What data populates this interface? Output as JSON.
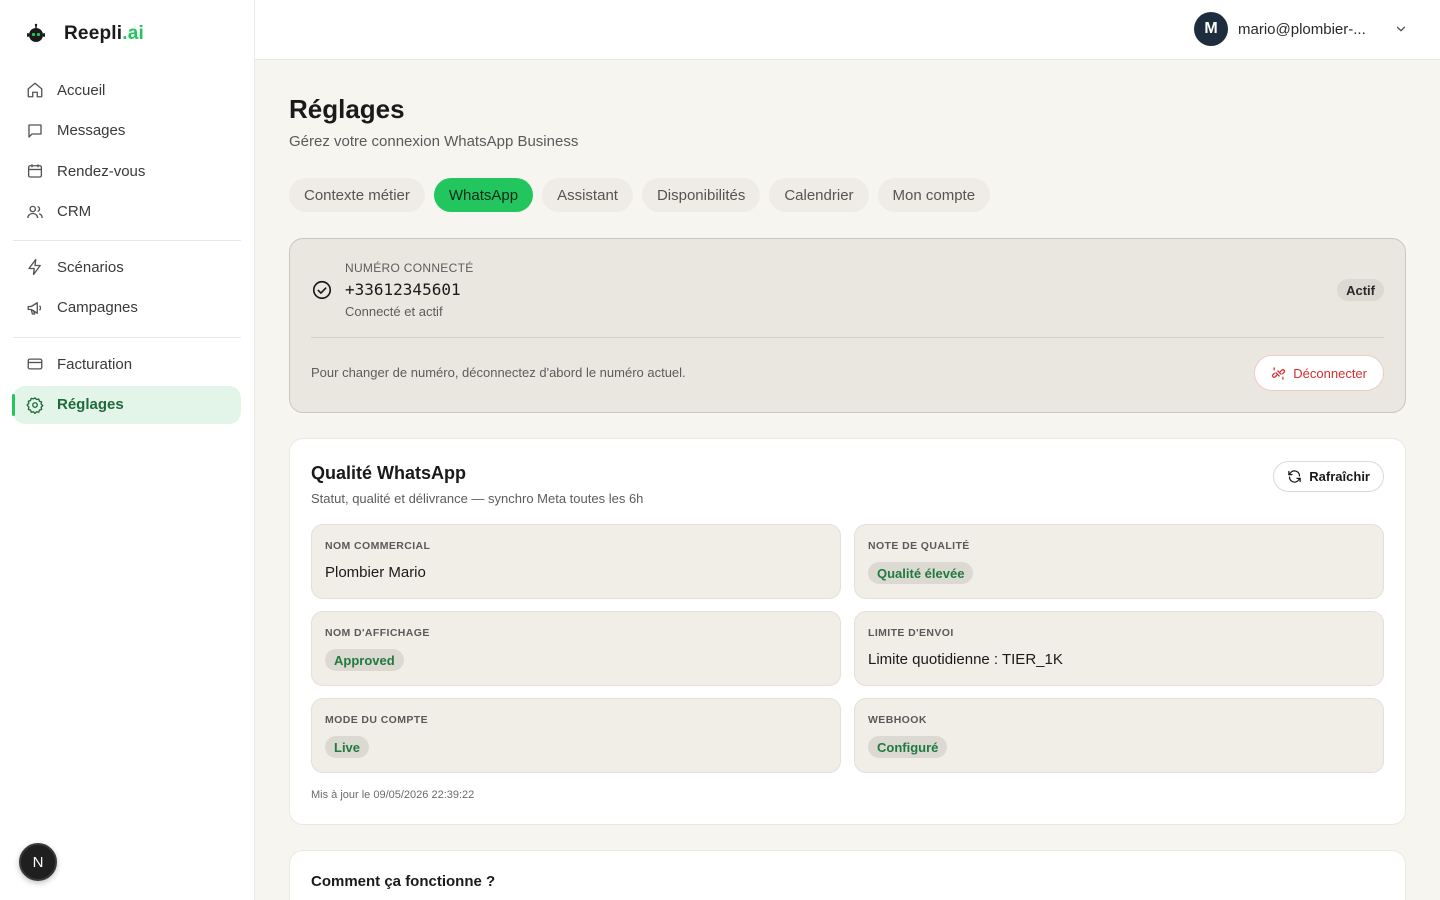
{
  "brand": {
    "name_main": "Reepli",
    "name_accent": ".ai",
    "logo_icon": "robot-icon"
  },
  "sidebar": {
    "group1": [
      {
        "label": "Accueil",
        "icon": "home-icon"
      },
      {
        "label": "Messages",
        "icon": "message-icon"
      },
      {
        "label": "Rendez-vous",
        "icon": "calendar-icon"
      },
      {
        "label": "CRM",
        "icon": "users-icon"
      }
    ],
    "group2": [
      {
        "label": "Scénarios",
        "icon": "lightning-icon"
      },
      {
        "label": "Campagnes",
        "icon": "megaphone-icon"
      }
    ],
    "group3": [
      {
        "label": "Facturation",
        "icon": "credit-card-icon"
      },
      {
        "label": "Réglages",
        "icon": "gear-icon",
        "active": true
      }
    ],
    "floating_badge": "N"
  },
  "topbar": {
    "avatar_initial": "M",
    "user_email": "mario@plombier-..."
  },
  "page": {
    "title": "Réglages",
    "subtitle": "Gérez votre connexion WhatsApp Business",
    "tabs": [
      "Contexte métier",
      "WhatsApp",
      "Assistant",
      "Disponibilités",
      "Calendrier",
      "Mon compte"
    ],
    "active_tab": "WhatsApp"
  },
  "connection": {
    "label": "NUMÉRO CONNECTÉ",
    "number": "+33612345601",
    "status": "Connecté et actif",
    "badge": "Actif",
    "help": "Pour changer de numéro, déconnectez d'abord le numéro actuel.",
    "disconnect_label": "Déconnecter"
  },
  "quality": {
    "title": "Qualité WhatsApp",
    "subtitle": "Statut, qualité et délivrance — synchro Meta toutes les 6h",
    "refresh_label": "Rafraîchir",
    "tiles": {
      "commercial_name": {
        "label": "NOM COMMERCIAL",
        "value": "Plombier Mario"
      },
      "quality_rating": {
        "label": "NOTE DE QUALITÉ",
        "value": "Qualité élevée"
      },
      "display_name": {
        "label": "NOM D'AFFICHAGE",
        "value": "Approved"
      },
      "send_limit": {
        "label": "LIMITE D'ENVOI",
        "value": "Limite quotidienne : TIER_1K"
      },
      "account_mode": {
        "label": "MODE DU COMPTE",
        "value": "Live"
      },
      "webhook": {
        "label": "WEBHOOK",
        "value": "Configuré"
      }
    },
    "updated": "Mis à jour le 09/05/2026 22:39:22"
  },
  "how_it_works": {
    "title": "Comment ça fonctionne ?"
  },
  "colors": {
    "accent": "#22c55e",
    "danger": "#d62f2f",
    "success_text": "#1f7a3f"
  }
}
